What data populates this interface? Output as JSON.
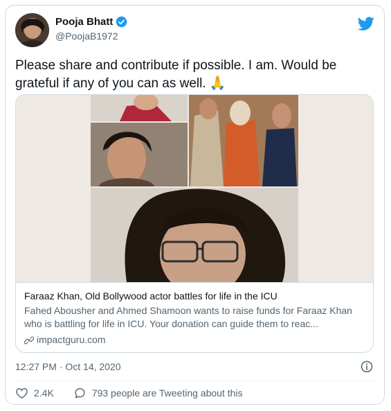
{
  "author": {
    "name": "Pooja Bhatt",
    "handle": "@PoojaB1972"
  },
  "tweet": {
    "text": "Please share and contribute if possible. I am. Would be grateful if any of you can as well. 🙏"
  },
  "link_card": {
    "title": "Faraaz Khan, Old Bollywood actor battles for life in the ICU",
    "description": "Fahed Abousher and Ahmed Shamoon wants to raise funds for Faraaz Khan who is battling for life in ICU. Your donation can guide them to reac...",
    "domain": "impactguru.com"
  },
  "timestamp": "12:27 PM · Oct 14, 2020",
  "actions": {
    "likes": "2.4K",
    "tweeting_about": "793 people are Tweeting about this"
  },
  "icons": {
    "verified": "verified-badge-icon",
    "brand": "twitter-bird-icon",
    "info": "info-icon",
    "like": "heart-icon",
    "reply": "speech-bubble-icon",
    "link": "link-icon"
  },
  "colors": {
    "brand": "#1d9bf0",
    "secondary_text": "#536471",
    "border": "#cfd9de"
  }
}
